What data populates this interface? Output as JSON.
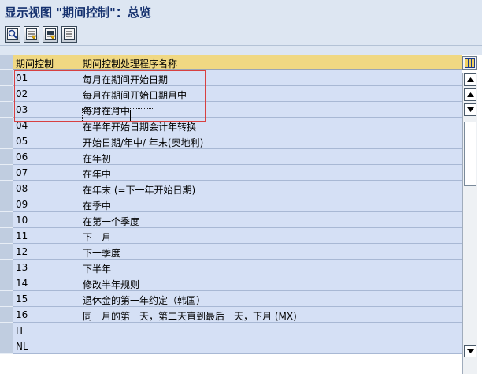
{
  "window": {
    "title": "显示视图 \"期间控制\"：总览"
  },
  "toolbar": {
    "buttons": [
      {
        "icon": "details-icon"
      },
      {
        "icon": "select-all-icon"
      },
      {
        "icon": "select-block-icon"
      },
      {
        "icon": "deselect-all-icon"
      }
    ]
  },
  "table": {
    "columns": [
      "期间控制",
      "期间控制处理程序名称"
    ],
    "rows": [
      {
        "code": "01",
        "name": "每月在期间开始日期"
      },
      {
        "code": "02",
        "name": "每月在期间开始日期月中"
      },
      {
        "code": "03",
        "name": "每月在月中"
      },
      {
        "code": "04",
        "name": "在半年开始日期会计年转换"
      },
      {
        "code": "05",
        "name": " 开始日期/年中/ 年末(奥地利)"
      },
      {
        "code": "06",
        "name": "在年初"
      },
      {
        "code": "07",
        "name": "在年中"
      },
      {
        "code": "08",
        "name": "在年末 (=下一年开始日期)"
      },
      {
        "code": "09",
        "name": "在季中"
      },
      {
        "code": "10",
        "name": "在第一个季度"
      },
      {
        "code": "11",
        "name": "下一月"
      },
      {
        "code": "12",
        "name": "下一季度"
      },
      {
        "code": "13",
        "name": "下半年"
      },
      {
        "code": "14",
        "name": "修改半年规则"
      },
      {
        "code": "15",
        "name": "退休金的第一年约定（韩国）"
      },
      {
        "code": "16",
        "name": "同一月的第一天，第二天直到最后一天，下月              (MX)"
      },
      {
        "code": "IT",
        "name": ""
      },
      {
        "code": "NL",
        "name": ""
      }
    ]
  },
  "colors": {
    "highlight": "#d84040",
    "header": "#f0d882",
    "row": "#d5e0f5",
    "title": "#14306e"
  }
}
